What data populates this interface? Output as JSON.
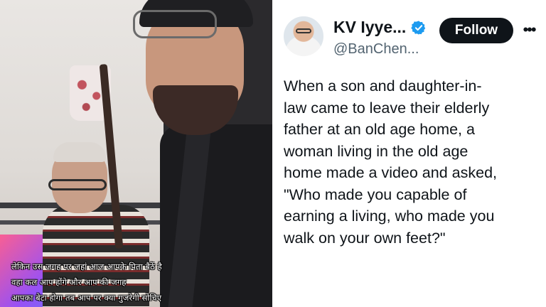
{
  "video": {
    "captions": [
      "लेकिन उस जगह पर जहां आज आपके पिता बैठें है",
      "वहा कल आप होंगे और आप की जगह",
      "आपका बेटा होगा तब आप पर क्या गुजरेगी सोचिए"
    ]
  },
  "tweet": {
    "display_name": "KV Iyye...",
    "handle": "@BanChen...",
    "follow_label": "Follow",
    "more_label": "•••",
    "verified_color": "#1d9bf0",
    "text_lines": [
      "When a son and daughter-in-",
      "law came to leave their elderly",
      "father at an old age home, a",
      "woman living in the old age",
      "home made a video and asked,",
      "\"Who made you capable of",
      "earning a living, who made you",
      "walk on your own feet?\""
    ]
  }
}
